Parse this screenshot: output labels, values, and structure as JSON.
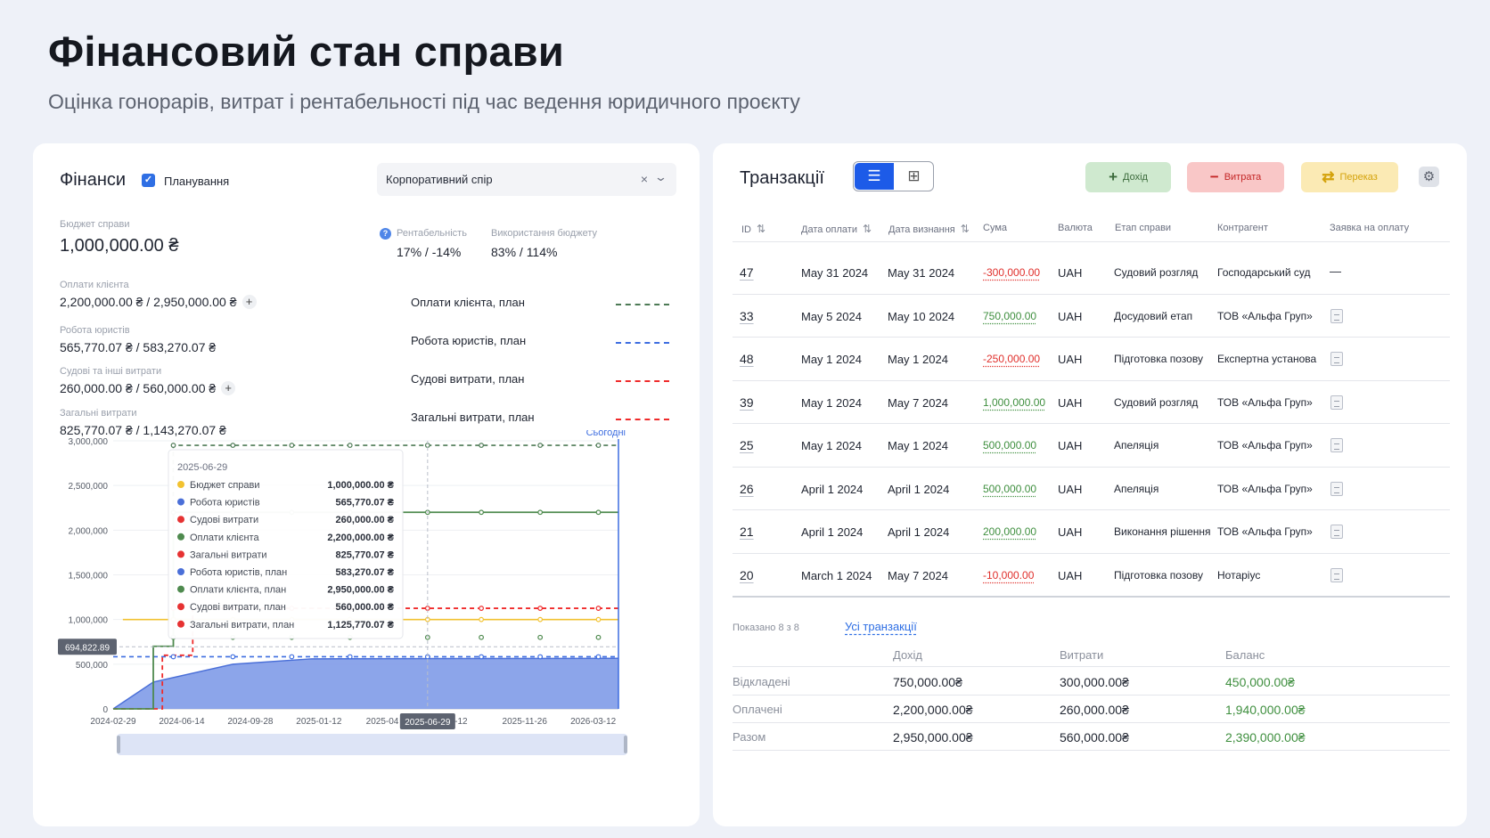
{
  "header": {
    "title": "Фінансовий стан справи",
    "subtitle": "Оцінка гонорарів, витрат і рентабельності під час ведення юридичного проєкту"
  },
  "finance": {
    "title": "Фінанси",
    "planning_label": "Планування",
    "planning_checked": true,
    "case_select": {
      "value": "Корпоративний спір",
      "clear": "×",
      "chevron": "⌄"
    },
    "budget": {
      "label": "Бюджет справи",
      "value": "1,000,000.00 ₴"
    },
    "profitability": {
      "label": "Рентабельність",
      "value": "17% / -14%"
    },
    "budget_usage": {
      "label": "Використання бюджету",
      "value": "83% / 114%"
    },
    "client_payments": {
      "label": "Оплати клієнта",
      "value": "2,200,000.00 ₴ / 2,950,000.00 ₴"
    },
    "lawyers_work": {
      "label": "Робота юристів",
      "value": "565,770.07 ₴ / 583,270.07 ₴"
    },
    "court_costs": {
      "label": "Судові та інші витрати",
      "value": "260,000.00 ₴ / 560,000.00 ₴"
    },
    "total_costs": {
      "label": "Загальні витрати",
      "value": "825,770.07 ₴ / 1,143,270.07 ₴"
    },
    "legend": [
      {
        "label": "Оплати клієнта, план",
        "color": "#4d7a55"
      },
      {
        "label": "Робота юристів, план",
        "color": "#3d6de0"
      },
      {
        "label": "Судові витрати, план",
        "color": "#ef2b2b"
      },
      {
        "label": "Загальні витрати, план",
        "color": "#ef2b2b"
      }
    ]
  },
  "chart_data": {
    "type": "line",
    "y_ticks": [
      "3,000,000",
      "2,500,000",
      "2,000,000",
      "1,500,000",
      "1,000,000",
      "500,000",
      "0"
    ],
    "ylim": [
      0,
      3000000
    ],
    "x_ticks": [
      "2024-02-29",
      "2024-06-14",
      "2024-09-28",
      "2025-01-12",
      "2025-04",
      "2025-06-29",
      "08-12",
      "2025-11-26",
      "2026-03-12"
    ],
    "today_label": "Сьогодні",
    "crosshair_y_label": "694,822.89",
    "crosshair_x_label": "2025-06-29",
    "series": [
      {
        "name": "Бюджет справи",
        "color": "#f2c230",
        "values_note": "flat",
        "points": [
          [
            "2024-03-15",
            1000000
          ],
          [
            "2026-04-20",
            1000000
          ]
        ]
      },
      {
        "name": "Оплати клієнта",
        "color": "#4e8a4e",
        "points": [
          [
            "2024-02-29",
            0
          ],
          [
            "2024-05-01",
            700000
          ],
          [
            "2024-06-01",
            2200000
          ],
          [
            "2026-04-20",
            2200000
          ]
        ]
      },
      {
        "name": "Загальні витрати, план",
        "color": "#ef2b2b",
        "points": [
          [
            "2024-02-29",
            0
          ],
          [
            "2024-05-15",
            600000
          ],
          [
            "2024-07-01",
            1125770.07
          ],
          [
            "2026-04-20",
            1125770.07
          ]
        ]
      },
      {
        "name": "Оплати клієнта, план",
        "color": "#4d7a55",
        "points": [
          [
            "2024-06-01",
            2950000
          ],
          [
            "2026-04-20",
            2950000
          ]
        ]
      },
      {
        "name": "Робота юристів",
        "color": "#4a6fd8",
        "points": [
          [
            "2024-02-29",
            0
          ],
          [
            "2024-05-01",
            300000
          ],
          [
            "2024-09-01",
            500000
          ],
          [
            "2025-01-01",
            560000
          ],
          [
            "2026-04-20",
            565770.07
          ]
        ]
      },
      {
        "name": "Робота юристів, план",
        "color": "#3d6de0",
        "points": [
          [
            "2024-02-29",
            583270.07
          ],
          [
            "2026-04-20",
            583270.07
          ]
        ]
      }
    ],
    "tooltip": {
      "date": "2025-06-29",
      "rows": [
        {
          "name": "Бюджет справи",
          "value": "1,000,000.00 ₴",
          "color": "#f2c230"
        },
        {
          "name": "Робота юристів",
          "value": "565,770.07 ₴",
          "color": "#4a6fd8"
        },
        {
          "name": "Судові витрати",
          "value": "260,000.00 ₴",
          "color": "#e63232"
        },
        {
          "name": "Оплати клієнта",
          "value": "2,200,000.00 ₴",
          "color": "#4e8a4e"
        },
        {
          "name": "Загальні витрати",
          "value": "825,770.07 ₴",
          "color": "#e63232"
        },
        {
          "name": "Робота юристів, план",
          "value": "583,270.07 ₴",
          "color": "#4a6fd8"
        },
        {
          "name": "Оплати клієнта, план",
          "value": "2,950,000.00 ₴",
          "color": "#4e8a4e"
        },
        {
          "name": "Судові витрати, план",
          "value": "560,000.00 ₴",
          "color": "#e63232"
        },
        {
          "name": "Загальні витрати, план",
          "value": "1,125,770.07 ₴",
          "color": "#e63232"
        }
      ]
    }
  },
  "transactions": {
    "title": "Транзакції",
    "buttons": {
      "income": "Дохід",
      "expense": "Витрата",
      "transfer": "Переказ"
    },
    "columns": [
      "ID",
      "Дата оплати",
      "Дата визнання",
      "Сума",
      "Валюта",
      "Етап справи",
      "Контрагент",
      "Заявка на оплату"
    ],
    "rows": [
      {
        "id": "47",
        "paid": "May 31 2024",
        "recognized": "May 31 2024",
        "amount": "-300,000.00",
        "sign": "neg",
        "currency": "UAH",
        "stage": "Судовий розгляд",
        "counterparty": "Господарський суд",
        "request": "—"
      },
      {
        "id": "33",
        "paid": "May 5 2024",
        "recognized": "May 10 2024",
        "amount": "750,000.00",
        "sign": "pos",
        "currency": "UAH",
        "stage": "Досудовий етап",
        "counterparty": "ТОВ «Альфа Груп»",
        "request": "doc"
      },
      {
        "id": "48",
        "paid": "May 1 2024",
        "recognized": "May 1 2024",
        "amount": "-250,000.00",
        "sign": "neg",
        "currency": "UAH",
        "stage": "Підготовка позову",
        "counterparty": "Експертна установа",
        "request": "doc"
      },
      {
        "id": "39",
        "paid": "May 1 2024",
        "recognized": "May 7 2024",
        "amount": "1,000,000.00",
        "sign": "pos",
        "currency": "UAH",
        "stage": "Судовий розгляд",
        "counterparty": "ТОВ «Альфа Груп»",
        "request": "doc"
      },
      {
        "id": "25",
        "paid": "May 1 2024",
        "recognized": "May 1 2024",
        "amount": "500,000.00",
        "sign": "pos",
        "currency": "UAH",
        "stage": "Апеляція",
        "counterparty": "ТОВ «Альфа Груп»",
        "request": "doc"
      },
      {
        "id": "26",
        "paid": "April 1 2024",
        "recognized": "April 1 2024",
        "amount": "500,000.00",
        "sign": "pos",
        "currency": "UAH",
        "stage": "Апеляція",
        "counterparty": "ТОВ «Альфа Груп»",
        "request": "doc"
      },
      {
        "id": "21",
        "paid": "April 1 2024",
        "recognized": "April 1 2024",
        "amount": "200,000.00",
        "sign": "pos",
        "currency": "UAH",
        "stage": "Виконання рішення",
        "counterparty": "ТОВ «Альфа Груп»",
        "request": "doc"
      },
      {
        "id": "20",
        "paid": "March 1 2024",
        "recognized": "May 7 2024",
        "amount": "-10,000.00",
        "sign": "neg",
        "currency": "UAH",
        "stage": "Підготовка позову",
        "counterparty": "Нотаріус",
        "request": "doc"
      }
    ],
    "shown_text": "Показано 8 з 8",
    "all_link": "Усі транзакції",
    "summary": {
      "headers": [
        "Дохід",
        "Витрати",
        "Баланс"
      ],
      "rows": [
        {
          "label": "Відкладені",
          "income": "750,000.00₴",
          "costs": "300,000.00₴",
          "balance": "450,000.00₴"
        },
        {
          "label": "Оплачені",
          "income": "2,200,000.00₴",
          "costs": "260,000.00₴",
          "balance": "1,940,000.00₴"
        },
        {
          "label": "Разом",
          "income": "2,950,000.00₴",
          "costs": "560,000.00₴",
          "balance": "2,390,000.00₴"
        }
      ]
    }
  }
}
